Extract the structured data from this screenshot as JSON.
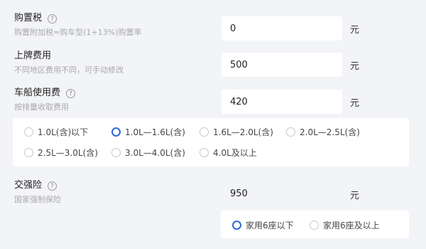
{
  "purchase_tax": {
    "label": "购置税",
    "help": "?",
    "hint": "购置附加税=购车型(1+13%)购置率",
    "value": "0",
    "unit": "元"
  },
  "plate_fee": {
    "label": "上牌费用",
    "hint": "不同地区费用不同，可手动修改",
    "value": "500",
    "unit": "元"
  },
  "vessel_tax": {
    "label": "车船使用费",
    "help": "?",
    "hint": "按排量收取费用",
    "value": "420",
    "unit": "元",
    "options": [
      "1.0L(含)以下",
      "1.0L—1.6L(含)",
      "1.6L—2.0L(含)",
      "2.0L—2.5L(含)",
      "2.5L—3.0L(含)",
      "3.0L—4.0L(含)",
      "4.0L及以上"
    ],
    "selected": "1.0L—1.6L(含)"
  },
  "compulsory_insurance": {
    "label": "交强险",
    "help": "?",
    "hint": "国家强制保险",
    "value": "950",
    "unit": "元",
    "options": [
      "家用6座以下",
      "家用6座及以上"
    ],
    "selected": "家用6座以下"
  },
  "colors": {
    "accent": "#2e6bd6",
    "background": "#f3f4f7"
  }
}
